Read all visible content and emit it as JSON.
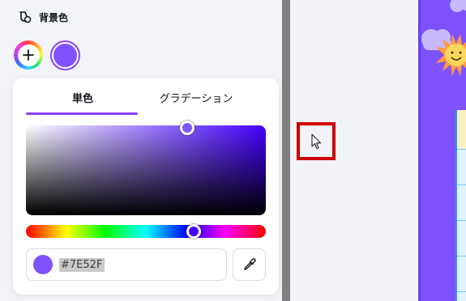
{
  "panel": {
    "title": "背景色",
    "tabs": [
      "単色",
      "グラデーション"
    ],
    "active_tab": "単色",
    "hex_value": "#7E52FF",
    "selected_color": "#7E52FF",
    "accent_color": "#8B3DFF"
  },
  "icons": {
    "header": "palette-bucket-icon",
    "add_color": "plus-icon",
    "eyedropper": "eyedropper-icon",
    "cursor": "mouse-pointer-icon"
  }
}
